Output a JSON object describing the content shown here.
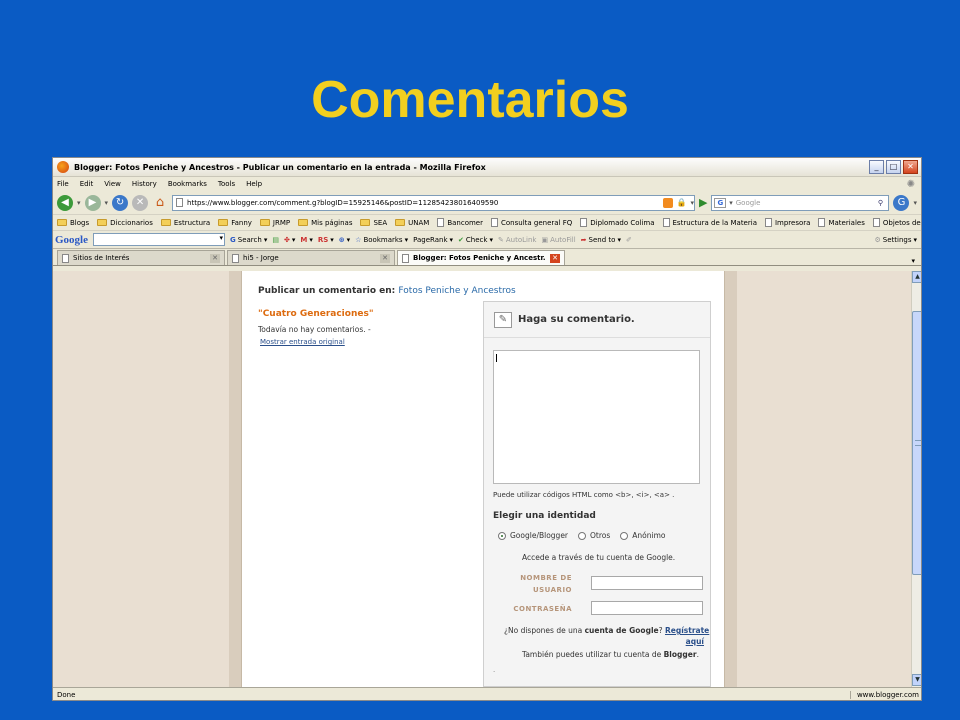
{
  "slide": {
    "title": "Comentarios"
  },
  "window": {
    "title": "Blogger: Fotos Peniche y Ancestros - Publicar un comentario en la entrada - Mozilla Firefox",
    "buttons": [
      "_",
      "□",
      "✕"
    ]
  },
  "menu": [
    "File",
    "Edit",
    "View",
    "History",
    "Bookmarks",
    "Tools",
    "Help"
  ],
  "navigation": {
    "url": "https://www.blogger.com/comment.g?blogID=15925146&postID=112854238016409590",
    "search_placeholder": "Google",
    "search_engine_badge": "G"
  },
  "bookmarks": [
    {
      "label": "Blogs",
      "type": "folder"
    },
    {
      "label": "Diccionarios",
      "type": "folder"
    },
    {
      "label": "Estructura",
      "type": "folder"
    },
    {
      "label": "Fanny",
      "type": "folder"
    },
    {
      "label": "JRMP",
      "type": "folder"
    },
    {
      "label": "Mis páginas",
      "type": "folder"
    },
    {
      "label": "SEA",
      "type": "folder"
    },
    {
      "label": "UNAM",
      "type": "folder"
    },
    {
      "label": "Bancomer",
      "type": "page"
    },
    {
      "label": "Consulta general FQ",
      "type": "page"
    },
    {
      "label": "Diplomado Colima",
      "type": "page"
    },
    {
      "label": "Estructura de la Materia",
      "type": "page"
    },
    {
      "label": "Impresora",
      "type": "page"
    },
    {
      "label": "Materiales",
      "type": "page"
    },
    {
      "label": "Objetos de Aprendizaje",
      "type": "page"
    }
  ],
  "google_toolbar": {
    "logo": "Google",
    "search_label": "Search",
    "bookmarks_label": "Bookmarks",
    "pagerank_label": "PageRank",
    "check_label": "Check",
    "autolink_label": "AutoLink",
    "autofill_label": "AutoFill",
    "sendto_label": "Send to",
    "settings_label": "Settings",
    "rs_label": "RS"
  },
  "tabs": [
    {
      "label": "Sitios de Interés",
      "active": false
    },
    {
      "label": "hi5 - Jorge",
      "active": false
    },
    {
      "label": "Blogger: Fotos Peniche y Ancestr...",
      "active": true
    }
  ],
  "page": {
    "post_for_label": "Publicar un comentario en:",
    "blog_name": "Fotos Peniche y Ancestros",
    "post_title": "\"Cuatro Generaciones\"",
    "no_comments": "Todavía no hay comentarios. -",
    "show_original": "Mostrar entrada original",
    "comment_header": "Haga su comentario.",
    "html_note": "Puede utilizar códigos HTML como <b>, <i>, <a> .",
    "identity_heading": "Elegir una identidad",
    "identity_options": [
      "Google/Blogger",
      "Otros",
      "Anónimo"
    ],
    "selected_identity": "Google/Blogger",
    "access_note": "Accede a través de tu cuenta de Google.",
    "username_label_1": "NOMBRE DE",
    "username_label_2": "USUARIO",
    "password_label": "CONTRASEÑA",
    "no_account_prefix": "¿No dispones de una",
    "no_account_bold": "cuenta de Google",
    "no_account_suffix": "?",
    "register_link_1": "Regístrate",
    "register_link_2": "aquí",
    "also_prefix": "También puedes utilizar tu cuenta de",
    "also_bold": "Blogger",
    "also_suffix": "."
  },
  "status": {
    "left": "Done",
    "right": "www.blogger.com"
  }
}
